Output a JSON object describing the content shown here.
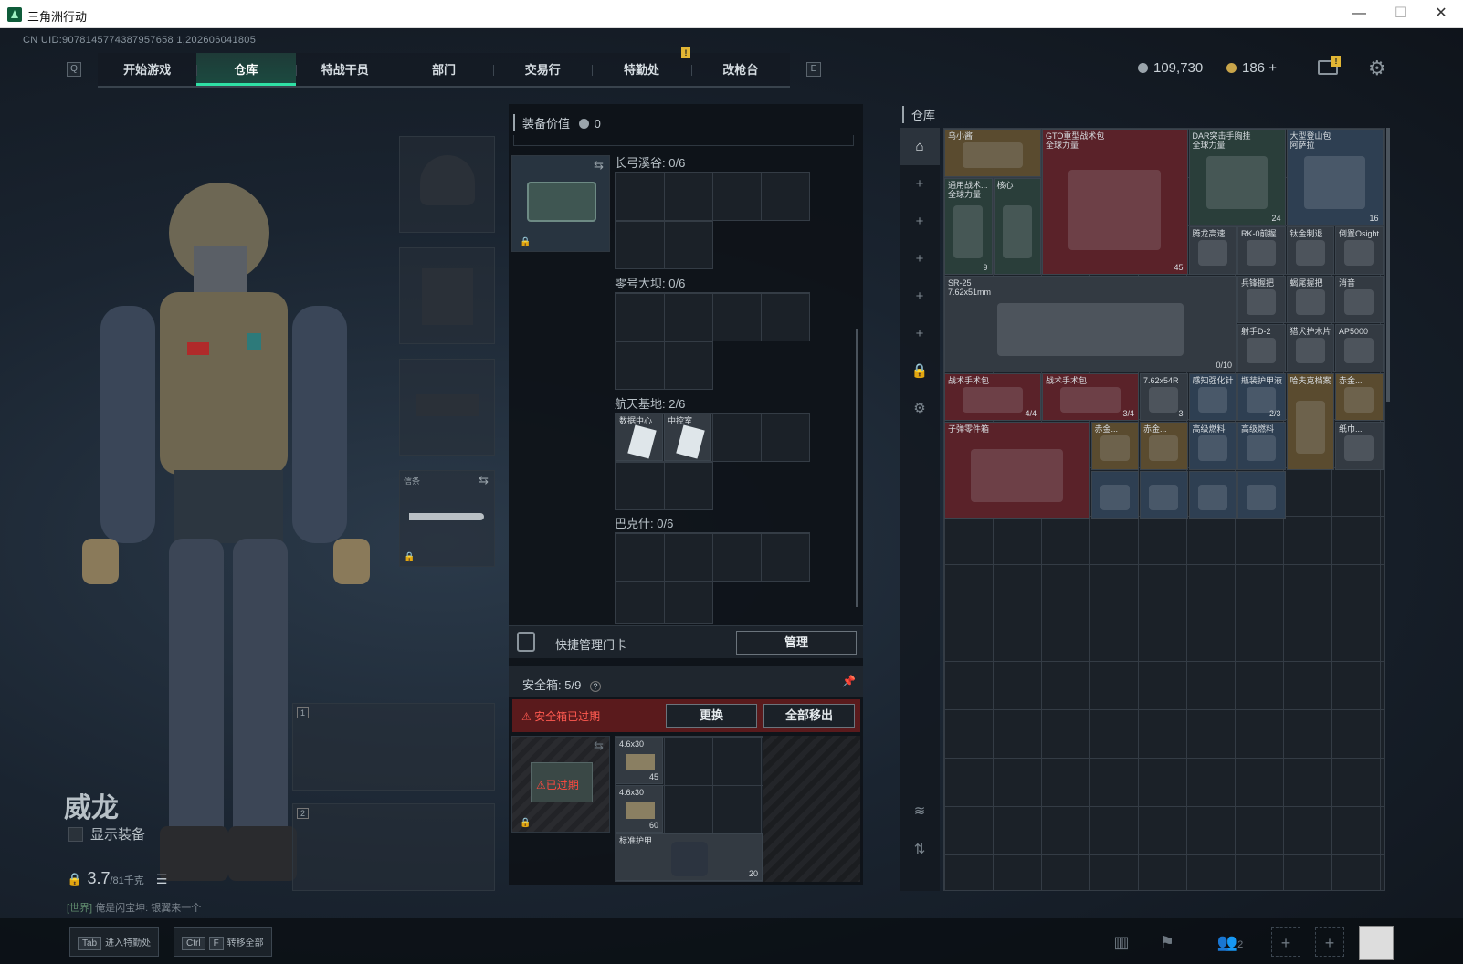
{
  "window": {
    "title": "三角洲行动",
    "min": "—",
    "max": "☐",
    "close": "✕"
  },
  "uid": "CN UID:9078145774387957658 1,202606041805",
  "nav": {
    "key_left": "Q",
    "key_right": "E",
    "tabs": [
      "开始游戏",
      "仓库",
      "特战干员",
      "部门",
      "交易行",
      "特勤处",
      "改枪台"
    ],
    "active": 1,
    "notif": "!"
  },
  "currency": {
    "silver": "109,730",
    "gold": "186 +",
    "mail_notif": "!"
  },
  "character": {
    "name": "威龙",
    "show_equipment": "显示装备",
    "weight": "3.7",
    "weight_unit": "/81千克",
    "chat_channel": "[世界]",
    "chat_text": "俺是闪宝坤: 银翼来一个"
  },
  "gear": {
    "melee_label": "信条",
    "weapon1_num": "1",
    "weapon2_num": "2"
  },
  "equipment": {
    "label": "装备价值",
    "value": "0"
  },
  "keycards": {
    "sections": [
      {
        "label": "长弓溪谷: 0/6"
      },
      {
        "label": "零号大坝: 0/6"
      },
      {
        "label": "航天基地: 2/6",
        "items": [
          "数据中心",
          "中控室"
        ]
      },
      {
        "label": "巴克什: 0/6"
      }
    ],
    "manage_label": "快捷管理门卡",
    "manage_btn": "管理"
  },
  "safebox": {
    "label": "安全箱:",
    "count": "5/9",
    "help": "?",
    "pin": "📌",
    "expired_msg": "安全箱已过期",
    "replace_btn": "更换",
    "remove_all_btn": "全部移出",
    "expired_tag": "已过期",
    "items": [
      {
        "name": "4.6x30",
        "count": "45"
      },
      {
        "name": "4.6x30",
        "count": "60"
      },
      {
        "name": "标准护甲",
        "count": "20"
      }
    ]
  },
  "storage": {
    "title": "仓库",
    "sidebar_icons": [
      "home-icon",
      "plus-icon",
      "plus-icon",
      "plus-icon",
      "plus-icon",
      "plus-icon",
      "lock-icon",
      "gear-icon",
      "layers-icon",
      "sort-icon"
    ],
    "items": [
      {
        "name": "乌小酱",
        "count": "",
        "color": "gold"
      },
      {
        "name": "GTO重型战术包\n全球力量",
        "count": "45",
        "color": "red"
      },
      {
        "name": "DAR突击手胸挂\n全球力量",
        "count": "24",
        "color": "teal"
      },
      {
        "name": "大型登山包\n阿萨拉",
        "count": "16",
        "color": "blue"
      },
      {
        "name": "通用战术...\n全球力量",
        "count": "9",
        "color": "teal"
      },
      {
        "name": "核心",
        "count": "",
        "color": "teal"
      },
      {
        "name": "腾龙高速...",
        "count": "",
        "color": "grey"
      },
      {
        "name": "RK-0前握",
        "count": "",
        "color": "grey"
      },
      {
        "name": "钛金制退",
        "count": "",
        "color": "grey"
      },
      {
        "name": "倒置Osight",
        "count": "",
        "color": "grey"
      },
      {
        "name": "SR-25\n7.62x51mm",
        "count": "0/10",
        "color": "grey"
      },
      {
        "name": "兵锋握把",
        "count": "",
        "color": "grey"
      },
      {
        "name": "蝎尾握把",
        "count": "",
        "color": "grey"
      },
      {
        "name": "消音",
        "count": "",
        "color": "grey"
      },
      {
        "name": "射手D-2",
        "count": "",
        "color": "grey"
      },
      {
        "name": "猎犬护木片",
        "count": "",
        "color": "grey"
      },
      {
        "name": "AP5000",
        "count": "",
        "color": "grey"
      },
      {
        "name": "战术手术包",
        "count": "4/4",
        "color": "red"
      },
      {
        "name": "战术手术包",
        "count": "3/4",
        "color": "red"
      },
      {
        "name": "7.62x54R",
        "count": "3",
        "color": "grey"
      },
      {
        "name": "感知强化针",
        "count": "",
        "color": "blue"
      },
      {
        "name": "瓶装护甲液",
        "count": "2/3",
        "color": "blue"
      },
      {
        "name": "哈夫克档案",
        "count": "",
        "color": "gold"
      },
      {
        "name": "赤金...",
        "count": "",
        "color": "gold"
      },
      {
        "name": "子弹零件箱",
        "count": "",
        "color": "red"
      },
      {
        "name": "赤金...",
        "count": "",
        "color": "gold"
      },
      {
        "name": "赤金...",
        "count": "",
        "color": "gold"
      },
      {
        "name": "高级燃料",
        "count": "",
        "color": "blue"
      },
      {
        "name": "高级燃料",
        "count": "",
        "color": "blue"
      },
      {
        "name": "纸巾...",
        "count": "",
        "color": "grey"
      },
      {
        "name": "",
        "count": "",
        "color": "blue"
      },
      {
        "name": "",
        "count": "",
        "color": "blue"
      },
      {
        "name": "",
        "count": "",
        "color": "blue"
      },
      {
        "name": "",
        "count": "",
        "color": "blue"
      }
    ]
  },
  "bottom": {
    "tab_key": "Tab",
    "tab_label": "进入特勤处",
    "ctrl_key": "Ctrl",
    "f_key": "F",
    "ctrl_label": "转移全部",
    "squad_count": "2"
  }
}
